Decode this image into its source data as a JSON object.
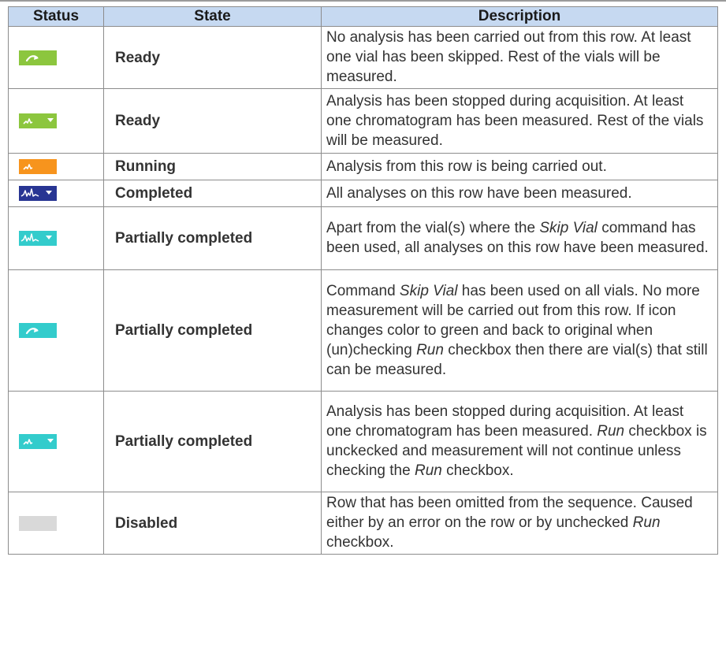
{
  "table": {
    "headers": {
      "status": "Status",
      "state": "State",
      "description": "Description"
    },
    "rows": [
      {
        "icon": "skip-arrow-icon",
        "icon_color": "#8cc63e",
        "state": "Ready",
        "description": [
          {
            "text": "No analysis has been carried out from this row. At least one vial has been skipped. Rest of the vials will be measured."
          }
        ]
      },
      {
        "icon": "small-peak-dropdown-icon",
        "icon_color": "#8cc63e",
        "state": "Ready",
        "description": [
          {
            "text": "Analysis has been stopped during acquisition. At least one chromatogram has been measured. Rest of the vials will be measured."
          }
        ]
      },
      {
        "icon": "small-peak-icon",
        "icon_color": "#f7941d",
        "state": "Running",
        "description": [
          {
            "text": "Analysis from this row is being carried out."
          }
        ]
      },
      {
        "icon": "chromatogram-dropdown-icon",
        "icon_color": "#283593",
        "state": "Completed",
        "description": [
          {
            "text": "All analyses on this row have been measured."
          }
        ]
      },
      {
        "icon": "chromatogram-dropdown-icon",
        "icon_color": "#33cccc",
        "state": "Partially completed",
        "description": [
          {
            "text": "Apart from the vial(s) where the "
          },
          {
            "text": "Skip Vial",
            "italic": true
          },
          {
            "text": " command has been used, all analyses on this row have been measured."
          }
        ]
      },
      {
        "icon": "skip-arrow-icon",
        "icon_color": "#33cccc",
        "state": "Partially completed",
        "description": [
          {
            "text": "Command "
          },
          {
            "text": "Skip Vial",
            "italic": true
          },
          {
            "text": " has been used on all vials. No more measurement will be carried out from this row. If icon changes color to green and back to original when (un)checking "
          },
          {
            "text": "Run",
            "italic": true
          },
          {
            "text": " checkbox then there are vial(s) that still can be measured."
          }
        ]
      },
      {
        "icon": "small-peak-dropdown-icon",
        "icon_color": "#33cccc",
        "state": "Partially completed",
        "description": [
          {
            "text": "Analysis has been stopped during acquisition. At least one chromatogram has been measured. "
          },
          {
            "text": "Run",
            "italic": true
          },
          {
            "text": " checkbox is unckecked and measurement will not continue unless checking the "
          },
          {
            "text": "Run",
            "italic": true
          },
          {
            "text": " checkbox."
          }
        ]
      },
      {
        "icon": "blank-status-icon",
        "icon_color": "#d9d9d9",
        "state": "Disabled",
        "description": [
          {
            "text": "Row that has been omitted from the sequence. Caused either by an error on the row or by unchecked "
          },
          {
            "text": "Run",
            "italic": true
          },
          {
            "text": " checkbox."
          }
        ]
      }
    ]
  }
}
